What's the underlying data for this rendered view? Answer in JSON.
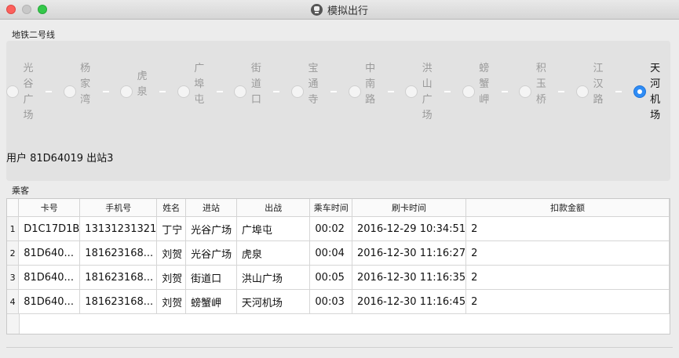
{
  "window": {
    "title": "模拟出行",
    "icon": "metro-train-icon"
  },
  "line": {
    "label": "地铁二号线",
    "stations": [
      {
        "name": "光谷广场",
        "selected": false
      },
      {
        "name": "杨家湾",
        "selected": false
      },
      {
        "name": "虎泉",
        "selected": false
      },
      {
        "name": "广埠屯",
        "selected": false
      },
      {
        "name": "街道口",
        "selected": false
      },
      {
        "name": "宝通寺",
        "selected": false
      },
      {
        "name": "中南路",
        "selected": false
      },
      {
        "name": "洪山广场",
        "selected": false
      },
      {
        "name": "螃蟹岬",
        "selected": false
      },
      {
        "name": "积玉桥",
        "selected": false
      },
      {
        "name": "江汉路",
        "selected": false
      },
      {
        "name": "天河机场",
        "selected": true
      }
    ],
    "status": "用户 81D64019 出站3"
  },
  "passengers": {
    "label": "乘客",
    "columns": [
      "卡号",
      "手机号",
      "姓名",
      "进站",
      "出战",
      "乘车时间",
      "刷卡时间",
      "扣款金额"
    ],
    "rows": [
      {
        "n": "1",
        "card": "D1C17D1B",
        "phone": "13131231321",
        "name": "丁宁",
        "entry": "光谷广场",
        "exit": "广埠屯",
        "ride": "00:02",
        "swipe": "2016-12-29 10:34:51",
        "fee": "2"
      },
      {
        "n": "2",
        "card": "81D640...",
        "phone": "181623168...",
        "name": "刘贺",
        "entry": "光谷广场",
        "exit": "虎泉",
        "ride": "00:04",
        "swipe": "2016-12-30 11:16:27",
        "fee": "2"
      },
      {
        "n": "3",
        "card": "81D640...",
        "phone": "181623168...",
        "name": "刘贺",
        "entry": "街道口",
        "exit": "洪山广场",
        "ride": "00:05",
        "swipe": "2016-12-30 11:16:35",
        "fee": "2"
      },
      {
        "n": "4",
        "card": "81D640...",
        "phone": "181623168...",
        "name": "刘贺",
        "entry": "螃蟹岬",
        "exit": "天河机场",
        "ride": "00:03",
        "swipe": "2016-12-30 11:16:45",
        "fee": "2"
      }
    ]
  }
}
